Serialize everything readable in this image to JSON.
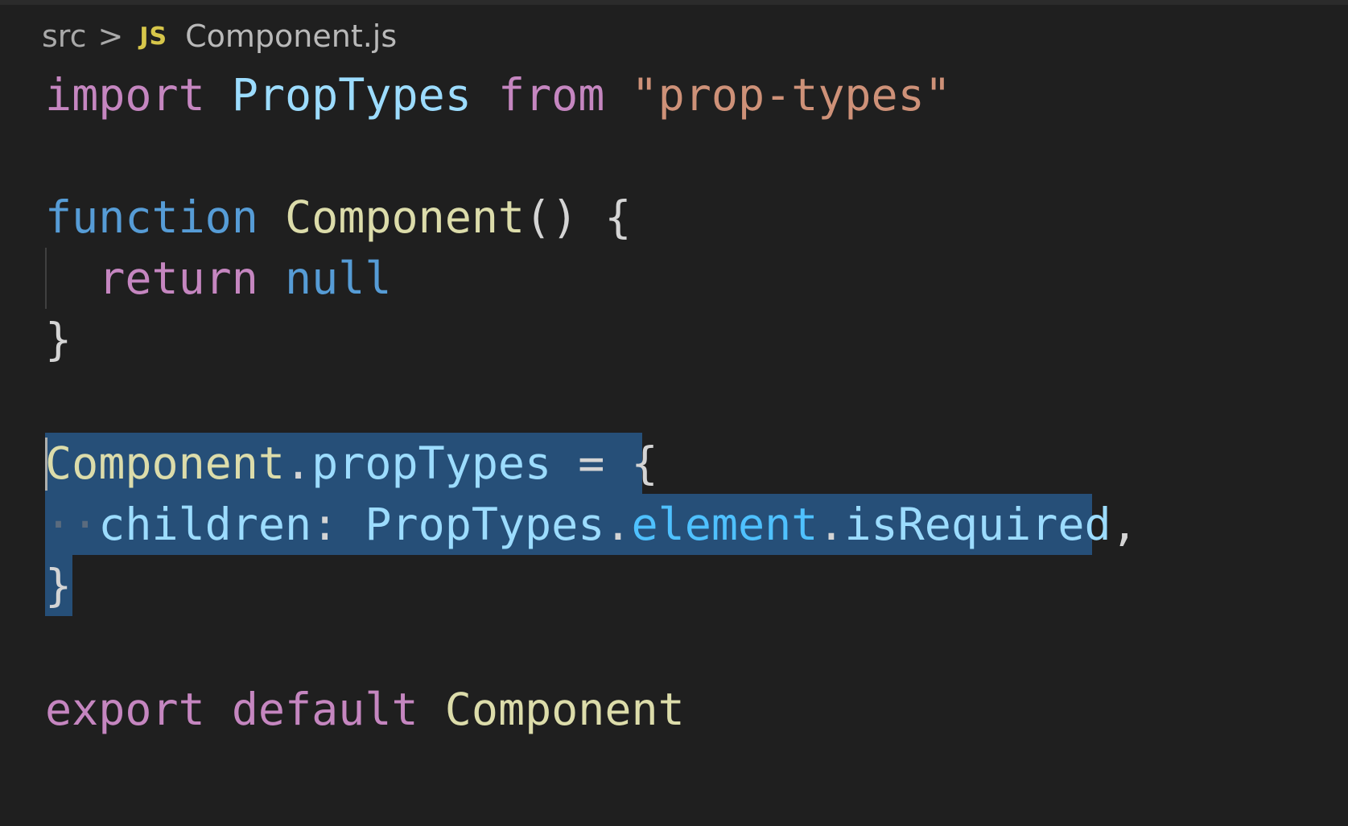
{
  "breadcrumb": {
    "folder": "src",
    "separator": ">",
    "file_icon": "JS",
    "file_name": "Component.js"
  },
  "code": {
    "line1": {
      "import_kw": "import",
      "import_name": "PropTypes",
      "from_kw": "from",
      "module": "\"prop-types\""
    },
    "line3": {
      "function_kw": "function",
      "function_name": "Component",
      "rest": "() {"
    },
    "line4": {
      "return_kw": "return",
      "null_kw": "null"
    },
    "line5": {
      "close": "}"
    },
    "line7": {
      "object": "Component",
      "dot": ".",
      "property": "propTypes",
      "assign": " = {"
    },
    "line8": {
      "key": "children",
      "colon": ": ",
      "object": "PropTypes",
      "dot1": ".",
      "member": "element",
      "dot2": ".",
      "member2": "isRequired",
      "comma": ","
    },
    "line9": {
      "close": "}"
    },
    "line11": {
      "export_kw": "export",
      "default_kw": "default",
      "name": "Component"
    }
  },
  "colors": {
    "background": "#1f1f1f",
    "selection": "#264f78",
    "keyword_control": "#c586c0",
    "keyword": "#569cd6",
    "string": "#ce9178",
    "function": "#dcdcaa",
    "variable": "#9cdcfe"
  }
}
